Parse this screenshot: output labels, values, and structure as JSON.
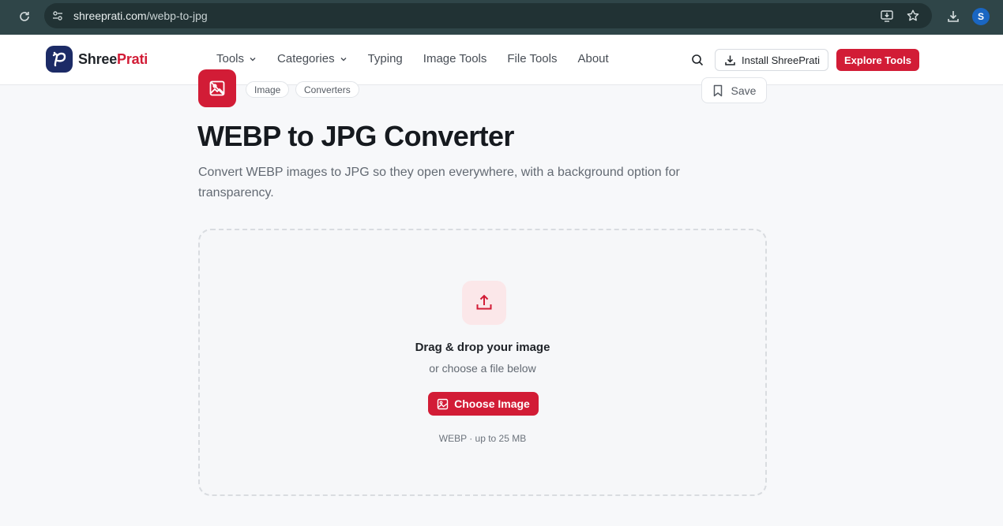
{
  "browser": {
    "url_domain": "shreeprati.com",
    "url_path": "/webp-to-jpg",
    "profile_initial": "S"
  },
  "header": {
    "logo_first": "Shree",
    "logo_second": "Prati",
    "nav": [
      {
        "label": "Tools",
        "has_dropdown": true
      },
      {
        "label": "Categories",
        "has_dropdown": true
      },
      {
        "label": "Typing",
        "has_dropdown": false
      },
      {
        "label": "Image Tools",
        "has_dropdown": false
      },
      {
        "label": "File Tools",
        "has_dropdown": false
      },
      {
        "label": "About",
        "has_dropdown": false
      }
    ],
    "install_label": "Install ShreePrati",
    "explore_label": "Explore Tools"
  },
  "tool": {
    "tags": [
      "Image",
      "Converters"
    ],
    "save_label": "Save",
    "title": "WEBP to JPG Converter",
    "description": "Convert WEBP images to JPG so they open everywhere, with a background option for transparency."
  },
  "dropzone": {
    "title": "Drag & drop your image",
    "subtitle": "or choose a file below",
    "button_label": "Choose Image",
    "limit_text": "WEBP · up to 25 MB"
  },
  "colors": {
    "brand": "#d21c36",
    "logo_bg": "#1c2b66",
    "chrome_bg": "#2f4548"
  }
}
